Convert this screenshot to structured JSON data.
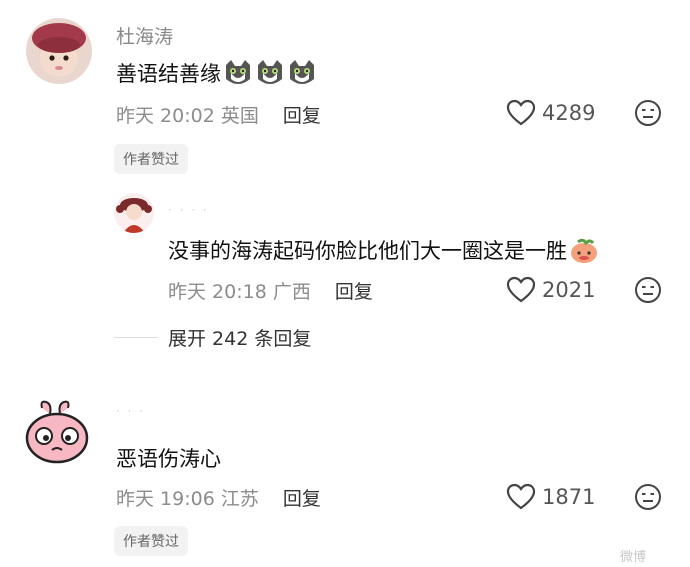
{
  "comments": [
    {
      "username": "杜海涛",
      "text": "善语结善缘",
      "time": "昨天 20:02",
      "location": "英国",
      "reply_label": "回复",
      "likes": "4289",
      "badge": "作者赞过",
      "emoji": "cat-sticker-icon"
    },
    {
      "text": "没事的海涛起码你脸比他们大一圈这是一胜",
      "time": "昨天 20:18",
      "location": "广西",
      "reply_label": "回复",
      "likes": "2021",
      "emoji": "peach-sticker-icon"
    },
    {
      "text": "恶语伤涛心",
      "time": "昨天 19:06",
      "location": "江苏",
      "reply_label": "回复",
      "likes": "1871",
      "badge": "作者赞过"
    }
  ],
  "expand_replies": "展开 242 条回复",
  "watermark": "微博",
  "colors": {
    "text": "#111111",
    "meta": "#8c8c8c",
    "badge_bg": "#f2f2f2",
    "accent_red": "#c0392b"
  }
}
